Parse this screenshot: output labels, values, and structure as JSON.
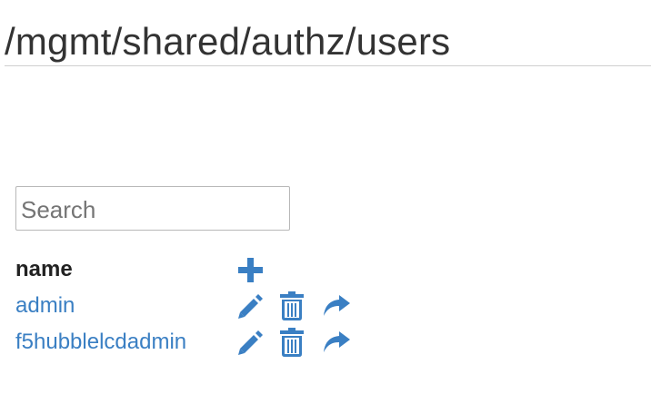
{
  "page": {
    "title": "/mgmt/shared/authz/users"
  },
  "search": {
    "placeholder": "Search",
    "value": ""
  },
  "table": {
    "column_name_header": "name",
    "add_icon": "plus-icon",
    "action_icons": [
      "pencil-icon",
      "trash-icon",
      "share-arrow-icon"
    ],
    "rows": [
      {
        "name": "admin"
      },
      {
        "name": "f5hubblelcdadmin"
      }
    ]
  },
  "colors": {
    "link": "#3a7fc3",
    "icon": "#3a7fc3",
    "text": "#333333",
    "rule": "#cfcfcf"
  }
}
